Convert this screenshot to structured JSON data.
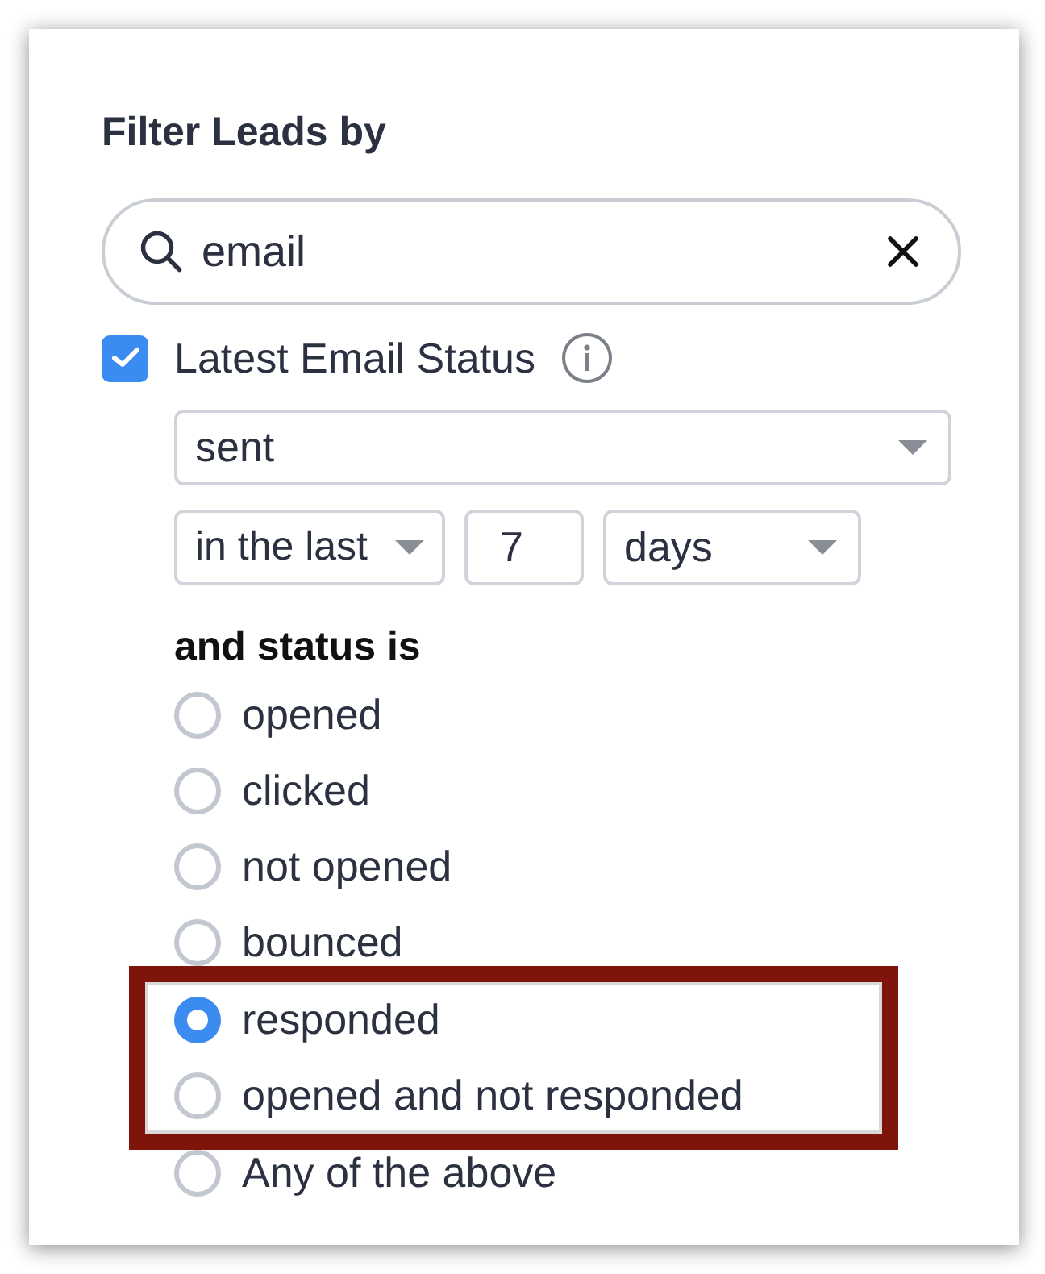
{
  "title": "Filter Leads by",
  "search": {
    "value": "email"
  },
  "field": {
    "label": "Latest Email Status",
    "checked": true
  },
  "status_select": {
    "value": "sent"
  },
  "period_select": {
    "value": "in the last"
  },
  "period_count": {
    "value": "7"
  },
  "unit_select": {
    "value": "days"
  },
  "status_heading": "and status is",
  "options": [
    {
      "label": "opened",
      "selected": false,
      "highlighted": false
    },
    {
      "label": "clicked",
      "selected": false,
      "highlighted": false
    },
    {
      "label": "not opened",
      "selected": false,
      "highlighted": false
    },
    {
      "label": "bounced",
      "selected": false,
      "highlighted": false
    },
    {
      "label": "responded",
      "selected": true,
      "highlighted": true
    },
    {
      "label": "opened and not responded",
      "selected": false,
      "highlighted": true
    },
    {
      "label": "Any of the above",
      "selected": false,
      "highlighted": false
    }
  ]
}
